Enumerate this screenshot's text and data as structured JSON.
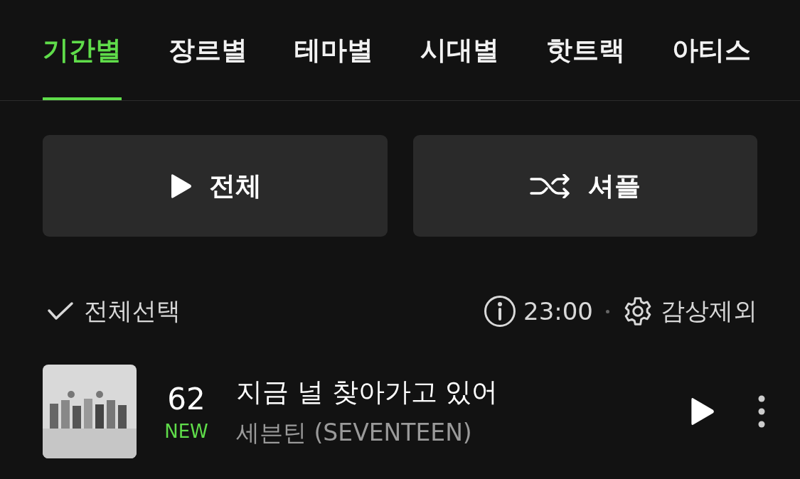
{
  "tabs": [
    {
      "label": "기간별",
      "selected": true
    },
    {
      "label": "장르별",
      "selected": false
    },
    {
      "label": "테마별",
      "selected": false
    },
    {
      "label": "시대별",
      "selected": false
    },
    {
      "label": "핫트랙",
      "selected": false
    },
    {
      "label": "아티스",
      "selected": false
    }
  ],
  "actions": [
    {
      "kind": "play",
      "label": "전체"
    },
    {
      "kind": "shuffle",
      "label": "셔플"
    }
  ],
  "toolbar": {
    "select_all": {
      "label": "전체선택",
      "checked": false
    },
    "time": "23:00",
    "exclude": "감상제외"
  },
  "tracks": [
    {
      "kind": "picture",
      "rank": "62",
      "badge": "NEW",
      "title": "지금 널 찾아가고 있어",
      "artist": "세븐틴 (SEVENTEEN)"
    }
  ]
}
